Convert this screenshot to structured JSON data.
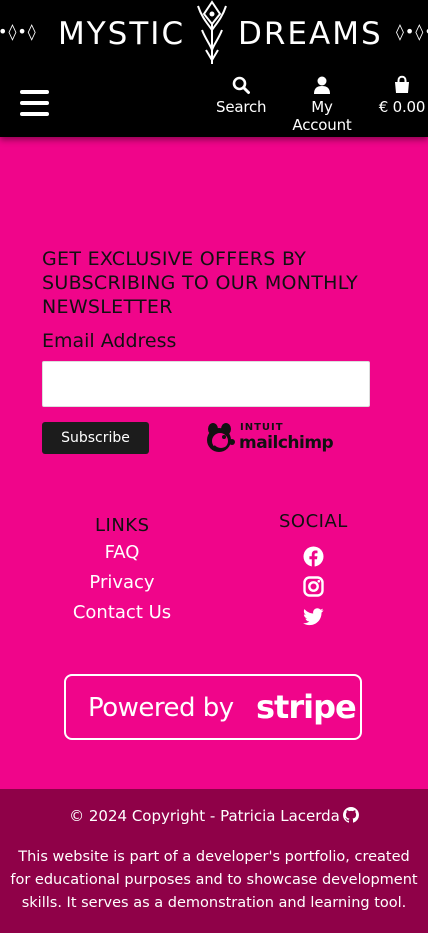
{
  "header": {
    "brand_left": "MYSTIC",
    "brand_right": "DREAMS",
    "brand_deco_left": "•◊•◊",
    "brand_deco_right": "◊•◊•",
    "nav": {
      "search_label": "Search",
      "account_label": "My Account",
      "cart_label": "€ 0.00"
    },
    "icons": [
      "menu-icon",
      "search-icon",
      "user-icon",
      "shopping-bag-icon"
    ]
  },
  "newsletter": {
    "heading": "GET EXCLUSIVE OFFERS BY SUBSCRIBING TO OUR MONTHLY NEWSLETTER",
    "email_label": "Email Address",
    "email_value": "",
    "subscribe_label": "Subscribe",
    "mailchimp_small": "INTUIT",
    "mailchimp_word": "mailchimp"
  },
  "links": {
    "title": "LINKS",
    "items": [
      "FAQ",
      "Privacy",
      "Contact Us"
    ]
  },
  "social": {
    "title": "SOCIAL",
    "icons": [
      "facebook-icon",
      "instagram-icon",
      "twitter-icon"
    ]
  },
  "stripe": {
    "powered": "Powered by",
    "brand": "stripe"
  },
  "footer": {
    "copyright": "© 2024 Copyright - Patricia Lacerda",
    "disclaimer": "This website is part of a developer's portfolio, created for educational purposes and to showcase development skills. It serves as a demonstration and learning tool."
  },
  "colors": {
    "page_bg": "#f0058a",
    "header_bg": "#000000",
    "footer_bg": "#8f0148",
    "button_bg": "#1c1c1c"
  }
}
